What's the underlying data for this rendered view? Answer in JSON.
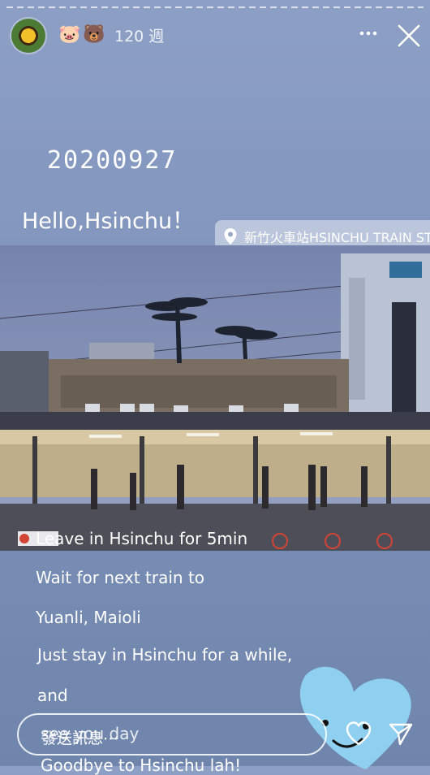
{
  "header": {
    "emoji_1": "🐷",
    "emoji_2": "🐻",
    "age": "120 週"
  },
  "story": {
    "date_text": "20200927",
    "greeting": "Hello,Hsinchu！",
    "location": "新竹火車站HSINCHU TRAIN STATION",
    "captions": [
      "Leave in Hsinchu for 5min",
      "Wait for next train to",
      "Yuanli, Maioli",
      "Just stay in Hsinchu for a while,",
      "and",
      "Goodbye to Hsinchu lah!"
    ],
    "caption_partial": "see you day"
  },
  "reply": {
    "placeholder": "發送訊息⋯"
  },
  "colors": {
    "background": "#7e93bc",
    "sticker": "#8fd0f0"
  }
}
